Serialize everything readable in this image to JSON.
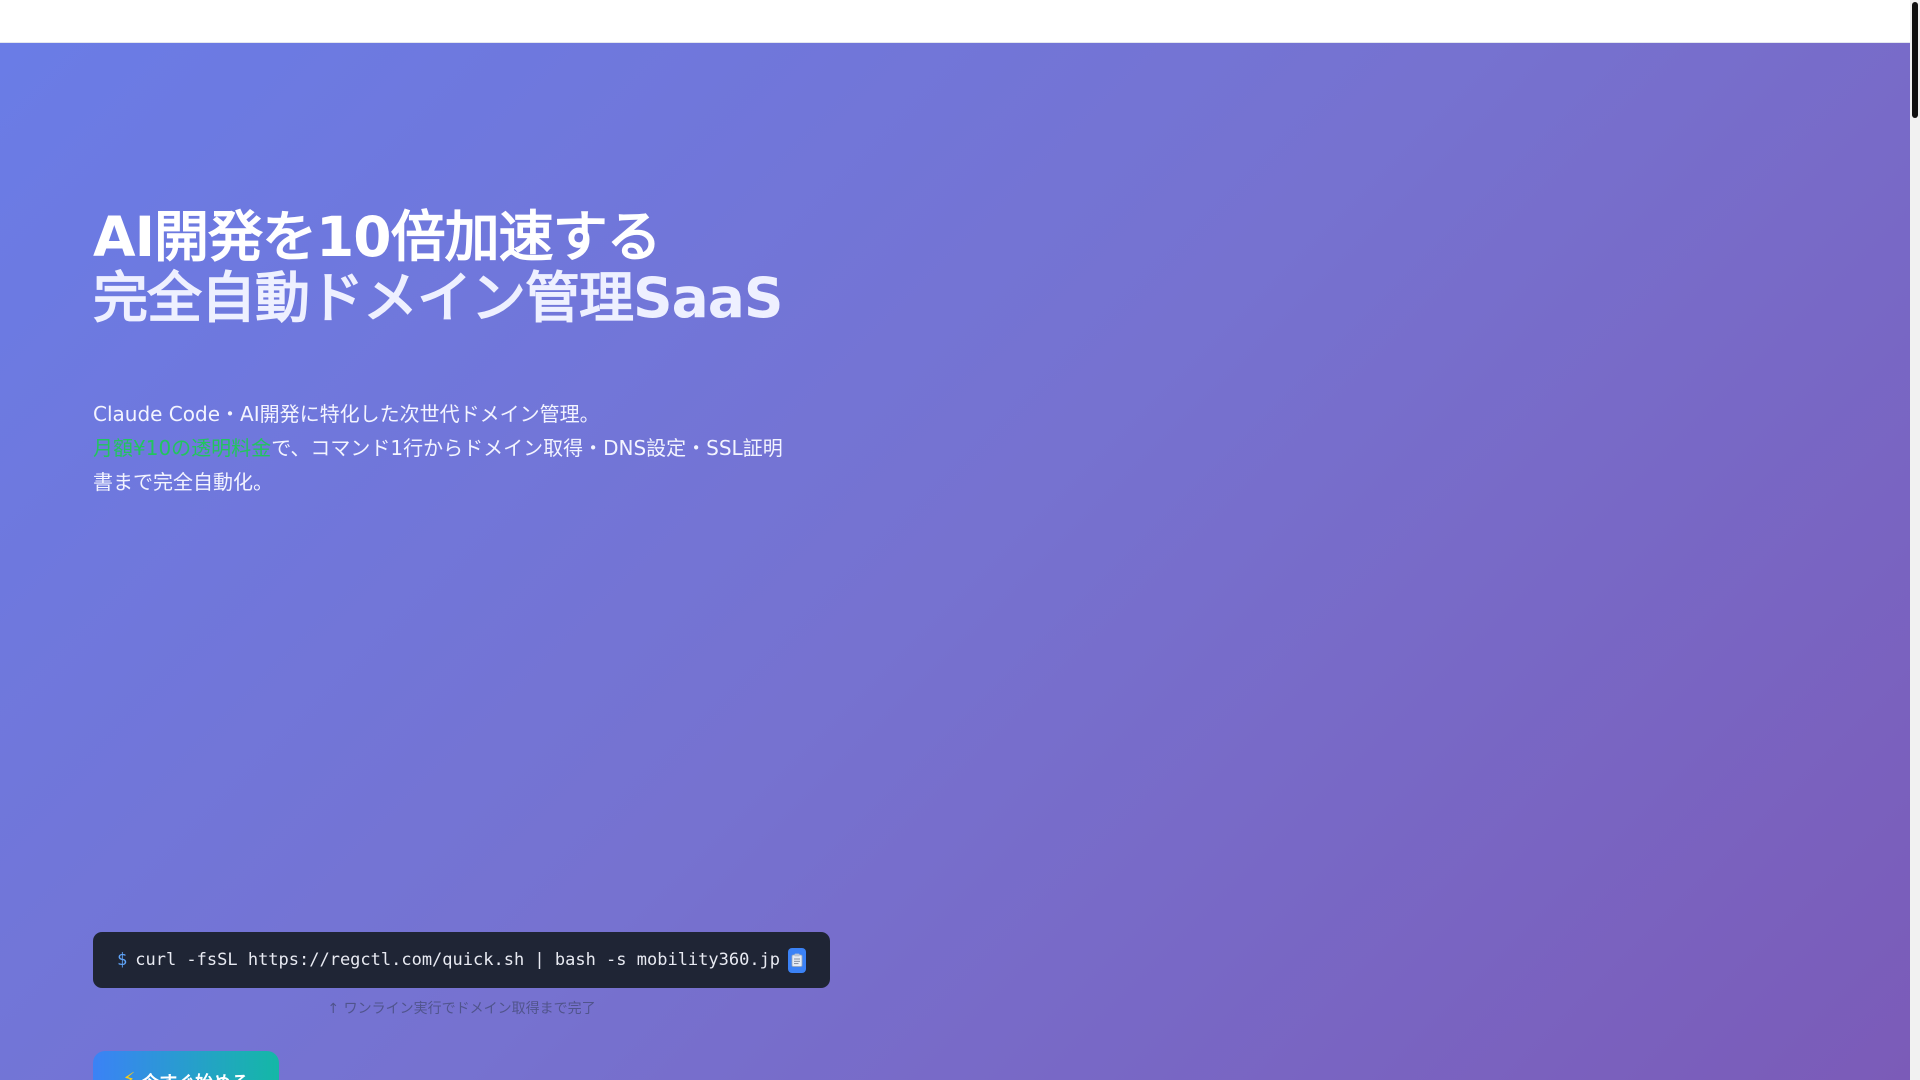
{
  "hero": {
    "headline_line1": "AI開発を10倍加速する",
    "headline_line2": "完全自動ドメイン管理SaaS",
    "subtitle_line1": "Claude Code・AI開発に特化した次世代ドメイン管理。",
    "subtitle_highlight": "月額¥10の透明料金",
    "subtitle_rest": "で、コマンド1行からドメイン取得・DNS設定・SSL証明書まで完全自動化。"
  },
  "command": {
    "prompt": "$",
    "text": "curl -fsSL https://regctl.com/quick.sh | bash -s mobility360.jp",
    "copy_icon": "clipboard-icon",
    "note": "↑ ワンライン実行でドメイン取得まで完了"
  },
  "cta": {
    "icon": "lightning-icon",
    "icon_glyph": "⚡",
    "label": "今すぐ始める"
  },
  "colors": {
    "hero_gradient_start": "#6a7ce6",
    "hero_gradient_end": "#7b5bb8",
    "highlight": "#22c55e",
    "command_bg": "#1f2535",
    "copy_button": "#3b82f6",
    "cta_gradient_start": "#3b82f6",
    "cta_gradient_end": "#14b8a6"
  }
}
